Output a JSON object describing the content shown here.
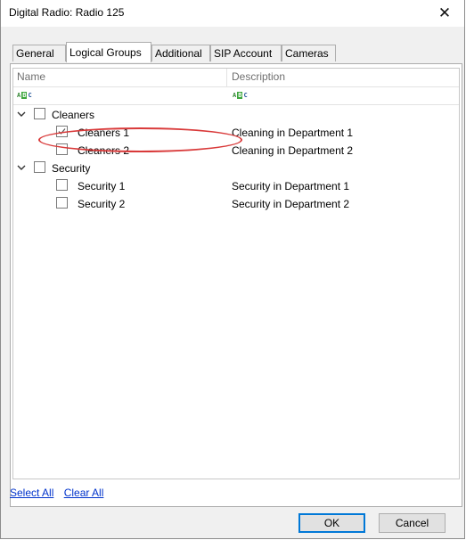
{
  "window": {
    "title": "Digital Radio: Radio 125",
    "close_glyph": "✕"
  },
  "tabs": [
    {
      "label": "General",
      "active": false
    },
    {
      "label": "Logical Groups",
      "active": true
    },
    {
      "label": "Additional",
      "active": false
    },
    {
      "label": "SIP Account",
      "active": false
    },
    {
      "label": "Cameras",
      "active": false
    }
  ],
  "grid": {
    "columns": {
      "name": "Name",
      "description": "Description"
    },
    "filter_icon": "abc-filter-icon",
    "rows": [
      {
        "label": "Cleaners",
        "description": "",
        "level": 0,
        "expanded": true,
        "checked": false
      },
      {
        "label": "Cleaners 1",
        "description": "Cleaning in Department 1",
        "level": 1,
        "checked": true
      },
      {
        "label": "Cleaners 2",
        "description": "Cleaning in Department 2",
        "level": 1,
        "checked": false
      },
      {
        "label": "Security",
        "description": "",
        "level": 0,
        "expanded": true,
        "checked": false
      },
      {
        "label": "Security 1",
        "description": "Security in Department 1",
        "level": 1,
        "checked": false
      },
      {
        "label": "Security 2",
        "description": "Security in Department 2",
        "level": 1,
        "checked": false
      }
    ]
  },
  "links": {
    "select_all": "Select All",
    "clear_all": "Clear All"
  },
  "buttons": {
    "ok": "OK",
    "cancel": "Cancel"
  },
  "colors": {
    "highlight": "#d93a3a",
    "link": "#0033cc",
    "default_button_border": "#0078d7"
  }
}
